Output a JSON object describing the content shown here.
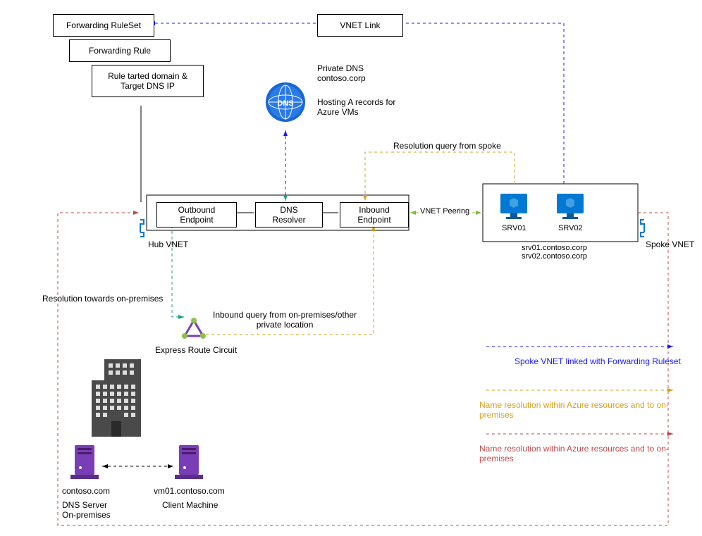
{
  "boxes": {
    "forwarding_ruleset": "Forwarding RuleSet",
    "forwarding_rule": "Forwarding Rule",
    "rule_target": "Rule tarted domain &\nTarget DNS IP",
    "vnet_link": "VNET Link",
    "outbound_endpoint": "Outbound\nEndpoint",
    "dns_resolver": "DNS\nResolver",
    "inbound_endpoint": "Inbound\nEndpoint"
  },
  "labels": {
    "private_dns": "Private DNS\ncontoso.corp",
    "hosting": "Hosting A records for\nAzure VMs",
    "resolution_spoke": "Resolution query from spoke",
    "vnet_peering": "VNET Peering",
    "srv01": "SRV01",
    "srv02": "SRV02",
    "srv_fqdn": "srv01.contoso.corp\nsrv02.contoso.corp",
    "spoke_vnet": "Spoke VNET",
    "hub_vnet": "Hub VNET",
    "resolution_onprem": "Resolution towards on-premises",
    "inbound_query": "Inbound query from on-premises/other\nprivate location",
    "express_route": "Express Route Circuit",
    "dns_server_domain": "contoso.com",
    "dns_server_role": "DNS Server\nOn-premises",
    "client_domain": "vm01.contoso.com",
    "client_role": "Client Machine"
  },
  "legend": {
    "blue": "Spoke VNET linked with Forwarding Ruleset",
    "orange": "Name resolution within Azure resources and to on-premises",
    "red": "Name resolution within Azure resources and to on-premises"
  },
  "icons": {
    "dns": "DNS"
  }
}
